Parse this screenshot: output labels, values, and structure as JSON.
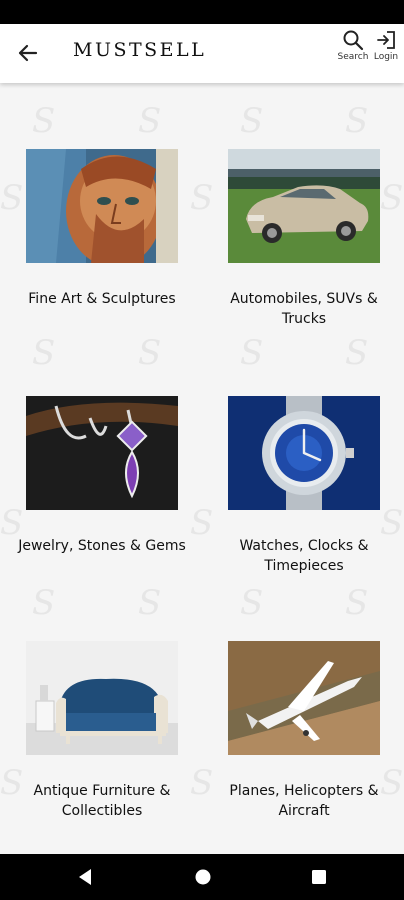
{
  "app": {
    "brand": "MUSTSELL"
  },
  "header": {
    "search_label": "Search",
    "login_label": "Login"
  },
  "categories": [
    {
      "label": "Fine Art & Sculptures",
      "image": "van-gogh-portrait"
    },
    {
      "label": "Automobiles, SUVs & Trucks",
      "image": "luxury-sedan"
    },
    {
      "label": "Jewelry, Stones & Gems",
      "image": "amethyst-necklace"
    },
    {
      "label": "Watches, Clocks & Timepieces",
      "image": "luxury-wristwatch"
    },
    {
      "label": "Antique Furniture & Collectibles",
      "image": "blue-antique-sofa"
    },
    {
      "label": "Planes, Helicopters & Aircraft",
      "image": "small-aircraft"
    }
  ]
}
